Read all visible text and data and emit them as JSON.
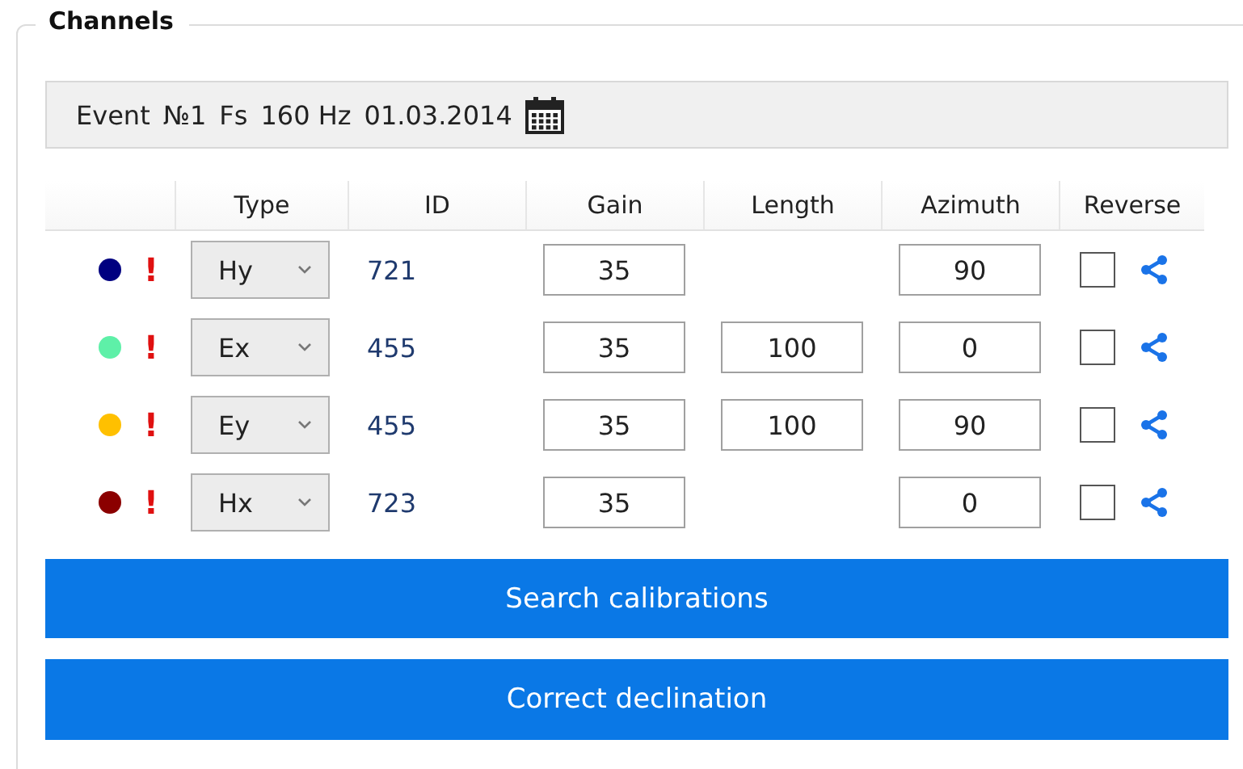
{
  "group": {
    "title": "Channels"
  },
  "event_bar": {
    "event_label": "Event",
    "event_number": "№1",
    "fs_label": "Fs",
    "fs_value": "160 Hz",
    "date": "01.03.2014"
  },
  "table": {
    "columns": [
      "Type",
      "ID",
      "Gain",
      "Length",
      "Azimuth",
      "Reverse"
    ],
    "rows": [
      {
        "color": "#000080",
        "warning": "!",
        "type": "Hy",
        "id": "721",
        "gain": "35",
        "azimuth": "90",
        "reverse": false
      },
      {
        "color": "#5ef0a8",
        "warning": "!",
        "type": "Ex",
        "id": "455",
        "gain": "35",
        "length": "100",
        "azimuth": "0",
        "reverse": false
      },
      {
        "color": "#ffc000",
        "warning": "!",
        "type": "Ey",
        "id": "455",
        "gain": "35",
        "length": "100",
        "azimuth": "90",
        "reverse": false
      },
      {
        "color": "#8b0000",
        "warning": "!",
        "type": "Hx",
        "id": "723",
        "gain": "35",
        "azimuth": "0",
        "reverse": false
      }
    ]
  },
  "buttons": [
    "Search calibrations",
    "Correct declination"
  ]
}
